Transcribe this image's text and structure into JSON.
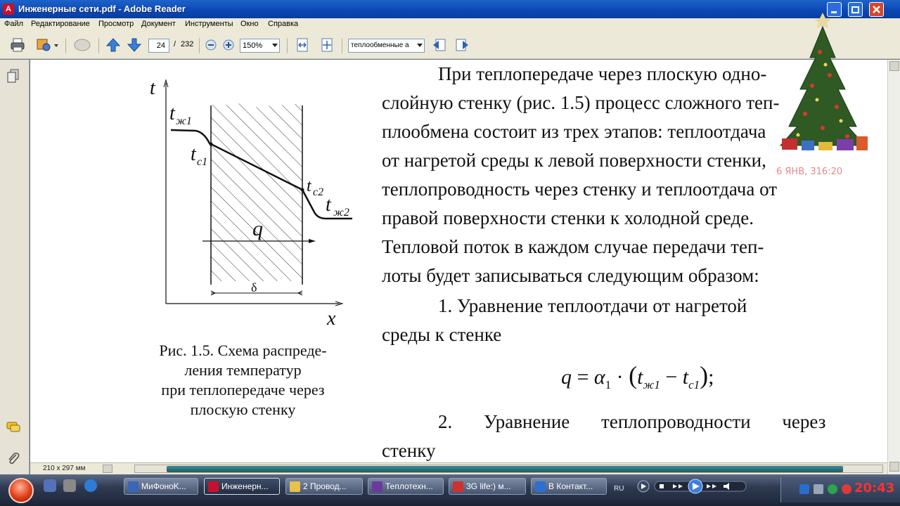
{
  "window": {
    "title": "Инженерные сети.pdf - Adobe Reader",
    "app_icon_glyph": "A"
  },
  "menu": [
    "Файл",
    "Редактирование",
    "Просмотр",
    "Документ",
    "Инструменты",
    "Окно",
    "Справка"
  ],
  "toolbar": {
    "current_page": "24",
    "page_separator": "/",
    "total_pages": "232",
    "zoom": "150%",
    "search_text": "теплообменные а"
  },
  "document": {
    "paragraph1": [
      "При теплопередаче через плоскую одно-",
      "слойную стенку (рис. 1.5) процесс сложного теп-",
      "плообмена состоит из трех этапов: теплоотдача",
      "от нагретой среды к левой поверхности стенки,",
      "теплопроводность через стенку и теплоотдача от",
      "правой поверхности стенки к холодной среде.",
      "Тепловой поток в каждом случае передачи теп-",
      "лоты будет записываться следующим образом:"
    ],
    "item1": [
      "1. Уравнение теплоотдачи от нагретой",
      "среды к стенке"
    ],
    "formula": {
      "q": "q",
      "eq": "=",
      "alpha": "α",
      "alpha_sub": "1",
      "dot": "·",
      "t_liquid": "t",
      "t_liquid_sub": "ж1",
      "minus": "−",
      "t_wall": "t",
      "t_wall_sub": "с1",
      "tail": ";"
    },
    "item2": [
      "2. Уравнение теплопроводности через",
      "стенку"
    ],
    "figure_labels": {
      "t_axis": "t",
      "x_axis": "x",
      "t_zh1": "t",
      "t_zh1_sub": "ж1",
      "t_c1": "t",
      "t_c1_sub": "с1",
      "t_c2": "t",
      "t_c2_sub": "с2",
      "t_zh2": "t",
      "t_zh2_sub": "ж2",
      "q": "q",
      "delta": "δ"
    },
    "caption": [
      "Рис. 1.5. Схема распреде-",
      "ления температур",
      "при теплопередаче через",
      "плоскую стенку"
    ]
  },
  "statusbar": {
    "page_size": "210 x 297 мм"
  },
  "widget": {
    "date_text": "6 ЯНВ, 316:20"
  },
  "taskbar": {
    "tasks": [
      {
        "label": "МиФонoK...",
        "icon_color": "#3a66b8"
      },
      {
        "label": "Инженерн...",
        "icon_color": "#c8102e"
      },
      {
        "label": "2 Провод...",
        "icon_color": "#e8c14a"
      },
      {
        "label": "Теплотехн...",
        "icon_color": "#6b3aa0"
      },
      {
        "label": "3G life:) м...",
        "icon_color": "#d03030"
      },
      {
        "label": "В Контакт...",
        "icon_color": "#2d6fd1"
      }
    ],
    "lang": "RU",
    "clock": "20:43"
  }
}
